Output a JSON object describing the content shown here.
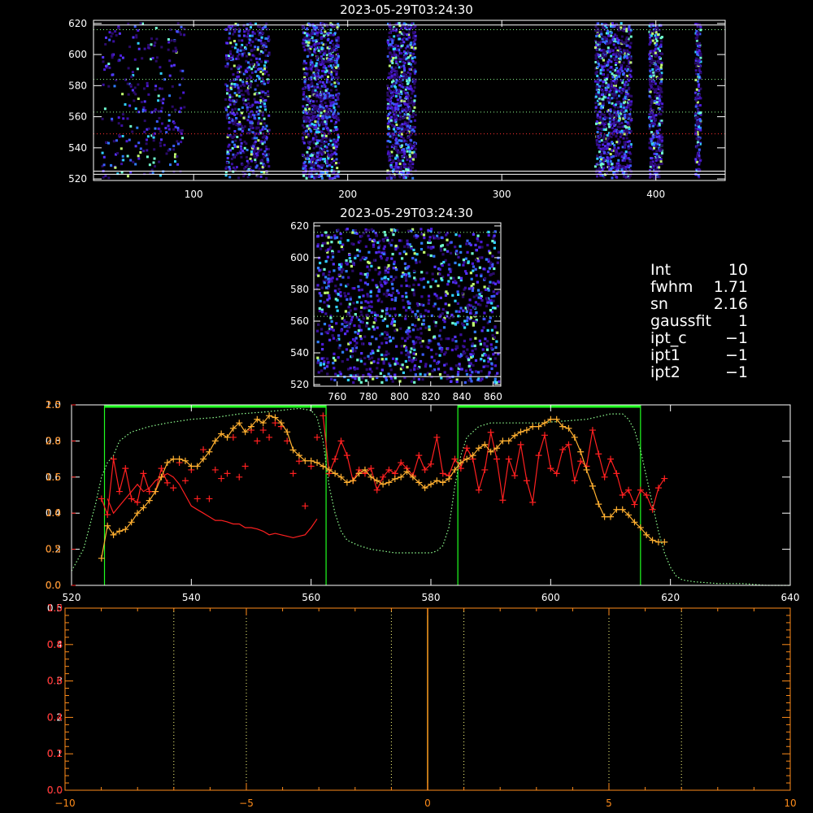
{
  "colors": {
    "background": "#000000",
    "axes": "#ffffff",
    "profile_red": "#ff2020",
    "profile_orange": "#ffb030",
    "guide_dotted": "#90ff90",
    "region_green": "#20ff20",
    "bottom_axes": "#ff8c1a",
    "bottom_dotted": "#ffff80",
    "center_line": "#ffa020"
  },
  "stats": [
    {
      "key": "Int",
      "value": "10"
    },
    {
      "key": "fwhm",
      "value": "1.71"
    },
    {
      "key": "sn",
      "value": "2.16"
    },
    {
      "key": "gaussfit",
      "value": "1"
    },
    {
      "key": "ipt_c",
      "value": "−1"
    },
    {
      "key": "ipt1",
      "value": "−1"
    },
    {
      "key": "ipt2",
      "value": "−1"
    }
  ],
  "chart_data": [
    {
      "type": "heatmap",
      "title": "2023-05-29T03:24:30",
      "xlim": [
        35,
        445
      ],
      "ylim": [
        519,
        622
      ],
      "x_ticks": [
        "100",
        "200",
        "300",
        "400"
      ],
      "y_ticks": [
        "520",
        "540",
        "560",
        "580",
        "600",
        "620"
      ],
      "bright_bands_x": [
        [
          40,
          95
        ],
        [
          120,
          150
        ],
        [
          170,
          195
        ],
        [
          225,
          245
        ],
        [
          360,
          385
        ],
        [
          395,
          405
        ],
        [
          425,
          430
        ]
      ],
      "horizontal_lines": [
        {
          "y": 619,
          "style": "solid",
          "color": "#ffffff"
        },
        {
          "y": 616,
          "style": "dotted",
          "color": "#90ff90"
        },
        {
          "y": 584,
          "style": "dotted",
          "color": "#90ff90"
        },
        {
          "y": 563,
          "style": "dotted",
          "color": "#90ff90"
        },
        {
          "y": 549,
          "style": "dotted",
          "color": "#ff3030"
        },
        {
          "y": 525,
          "style": "solid",
          "color": "#ffffff"
        },
        {
          "y": 523,
          "style": "solid",
          "color": "#ffffff"
        }
      ]
    },
    {
      "type": "heatmap",
      "title": "2023-05-29T03:24:30",
      "xlim": [
        745,
        865
      ],
      "ylim": [
        519,
        622
      ],
      "x_ticks": [
        "760",
        "780",
        "800",
        "820",
        "840",
        "860"
      ],
      "y_ticks": [
        "520",
        "540",
        "560",
        "580",
        "600",
        "620"
      ],
      "horizontal_lines": [
        {
          "y": 616,
          "style": "dotted",
          "color": "#90ff90"
        },
        {
          "y": 563,
          "style": "dotted",
          "color": "#90ff90"
        },
        {
          "y": 525,
          "style": "solid",
          "color": "#ffffff"
        }
      ]
    },
    {
      "type": "line",
      "xlim": [
        520,
        640
      ],
      "ylim": [
        0,
        1.0
      ],
      "x_ticks": [
        "520",
        "540",
        "560",
        "580",
        "600",
        "620",
        "640"
      ],
      "y_ticks_white": [
        "0.0",
        "0.2",
        "0.4",
        "0.6",
        "0.8",
        "1.0"
      ],
      "y_ticks_orange": [
        "0.0",
        "0.5",
        "1.0",
        "1.5",
        "2.0",
        "2.5"
      ],
      "regions": [
        [
          525.5,
          562.5
        ],
        [
          584.5,
          615
        ]
      ],
      "series": [
        {
          "color": "#ff2020",
          "marker": "+",
          "x": [
            525,
            526,
            527,
            528,
            529,
            530,
            531,
            532,
            533,
            534,
            535,
            536,
            537,
            538,
            539,
            540,
            541,
            542,
            543,
            544,
            545,
            546,
            547,
            548,
            549,
            550,
            551,
            552,
            553,
            554,
            555,
            556,
            557,
            558,
            559,
            560,
            561,
            562,
            563,
            564,
            565,
            566,
            567,
            568,
            569,
            570,
            571,
            572,
            573,
            574,
            575,
            576,
            577,
            578,
            579,
            580,
            581,
            582,
            583,
            584,
            585,
            586,
            587,
            588,
            589,
            590,
            591,
            592,
            593,
            594,
            595,
            596,
            597,
            598,
            599,
            600,
            601,
            602,
            603,
            604,
            605,
            606,
            607,
            608,
            609,
            610,
            611,
            612,
            613,
            614,
            615,
            616,
            617,
            618,
            619
          ],
          "y": [
            1.2,
            0.98,
            1.75,
            1.3,
            1.62,
            1.2,
            1.15,
            1.55,
            1.3,
            1.3,
            1.62,
            1.42,
            1.35,
            1.7,
            1.45,
            1.6,
            1.2,
            1.88,
            1.2,
            1.6,
            1.48,
            1.55,
            2.05,
            1.5,
            1.65,
            2.15,
            2.0,
            2.15,
            2.05,
            2.25,
            2.2,
            2.0,
            1.55,
            1.72,
            1.1,
            1.65,
            2.05,
            2.35,
            1.55,
            1.75,
            2.0,
            1.8,
            1.45,
            1.6,
            1.55,
            1.62,
            1.32,
            1.5,
            1.6,
            1.55,
            1.7,
            1.62,
            1.52,
            1.8,
            1.6,
            1.68,
            2.05,
            1.55,
            1.52,
            1.75,
            1.62,
            1.9,
            1.75,
            1.32,
            1.6,
            2.12,
            1.75,
            1.18,
            1.75,
            1.52,
            1.95,
            1.45,
            1.15,
            1.8,
            2.08,
            1.62,
            1.55,
            1.88,
            1.95,
            1.45,
            1.72,
            1.65,
            2.15,
            1.82,
            1.5,
            1.75,
            1.55,
            1.25,
            1.32,
            1.12,
            1.32,
            1.25,
            1.05,
            1.35,
            1.48
          ],
          "x2": [
            526,
            527,
            528,
            529,
            530,
            531,
            532,
            533,
            534,
            535,
            536,
            537,
            538,
            539,
            540,
            541,
            542,
            543,
            544,
            545,
            546,
            547,
            548,
            549,
            550,
            551,
            552,
            553,
            554,
            555,
            556,
            557,
            558,
            559,
            560,
            561
          ],
          "y2": [
            1.2,
            1.0,
            1.1,
            1.2,
            1.3,
            1.4,
            1.3,
            1.35,
            1.45,
            1.5,
            1.55,
            1.5,
            1.4,
            1.25,
            1.1,
            1.05,
            1.0,
            0.95,
            0.9,
            0.9,
            0.88,
            0.85,
            0.85,
            0.8,
            0.8,
            0.78,
            0.75,
            0.7,
            0.72,
            0.7,
            0.68,
            0.66,
            0.68,
            0.7,
            0.8,
            0.92
          ]
        },
        {
          "color": "#ffb030",
          "marker": "+",
          "x": [
            525,
            526,
            527,
            528,
            529,
            530,
            531,
            532,
            533,
            534,
            535,
            536,
            537,
            538,
            539,
            540,
            541,
            542,
            543,
            544,
            545,
            546,
            547,
            548,
            549,
            550,
            551,
            552,
            553,
            554,
            555,
            556,
            557,
            558,
            559,
            560,
            561,
            562,
            563,
            564,
            565,
            566,
            567,
            568,
            569,
            570,
            571,
            572,
            573,
            574,
            575,
            576,
            577,
            578,
            579,
            580,
            581,
            582,
            583,
            584,
            585,
            586,
            587,
            588,
            589,
            590,
            591,
            592,
            593,
            594,
            595,
            596,
            597,
            598,
            599,
            600,
            601,
            602,
            603,
            604,
            605,
            606,
            607,
            608,
            609,
            610,
            611,
            612,
            613,
            614,
            615,
            616,
            617,
            618,
            619
          ],
          "y": [
            0.15,
            0.33,
            0.28,
            0.3,
            0.31,
            0.35,
            0.4,
            0.43,
            0.47,
            0.52,
            0.6,
            0.68,
            0.7,
            0.7,
            0.69,
            0.66,
            0.66,
            0.7,
            0.74,
            0.8,
            0.84,
            0.82,
            0.87,
            0.9,
            0.85,
            0.88,
            0.92,
            0.9,
            0.94,
            0.93,
            0.9,
            0.85,
            0.75,
            0.72,
            0.69,
            0.69,
            0.68,
            0.66,
            0.64,
            0.62,
            0.6,
            0.57,
            0.58,
            0.62,
            0.64,
            0.6,
            0.58,
            0.56,
            0.57,
            0.59,
            0.6,
            0.63,
            0.6,
            0.57,
            0.54,
            0.56,
            0.58,
            0.57,
            0.59,
            0.64,
            0.68,
            0.7,
            0.72,
            0.76,
            0.78,
            0.74,
            0.76,
            0.8,
            0.8,
            0.83,
            0.85,
            0.86,
            0.88,
            0.88,
            0.9,
            0.92,
            0.92,
            0.88,
            0.87,
            0.82,
            0.74,
            0.64,
            0.55,
            0.45,
            0.38,
            0.38,
            0.42,
            0.42,
            0.39,
            0.35,
            0.32,
            0.28,
            0.25,
            0.24,
            0.24
          ]
        },
        {
          "color": "#90ff90",
          "style": "dotted",
          "x": [
            520,
            522,
            524,
            525,
            526,
            527,
            528,
            530,
            533,
            536,
            540,
            544,
            548,
            552,
            555,
            558,
            560,
            561,
            562,
            563,
            564,
            565,
            566,
            568,
            570,
            574,
            578,
            580,
            581,
            582,
            583,
            584,
            585,
            586,
            588,
            590,
            594,
            598,
            602,
            606,
            610,
            612,
            613,
            614,
            615,
            616,
            617,
            618,
            619,
            620,
            621,
            622,
            624,
            628,
            632,
            636,
            640
          ],
          "y": [
            0.08,
            0.2,
            0.45,
            0.6,
            0.68,
            0.72,
            0.8,
            0.85,
            0.88,
            0.9,
            0.92,
            0.93,
            0.95,
            0.96,
            0.97,
            0.98,
            0.97,
            0.93,
            0.8,
            0.55,
            0.4,
            0.3,
            0.25,
            0.22,
            0.2,
            0.18,
            0.18,
            0.18,
            0.19,
            0.22,
            0.32,
            0.55,
            0.72,
            0.82,
            0.88,
            0.9,
            0.9,
            0.9,
            0.91,
            0.92,
            0.95,
            0.95,
            0.92,
            0.86,
            0.75,
            0.6,
            0.45,
            0.3,
            0.18,
            0.1,
            0.05,
            0.03,
            0.02,
            0.01,
            0.01,
            0.0,
            0.0
          ]
        }
      ]
    },
    {
      "type": "line",
      "xlim": [
        -10,
        10
      ],
      "ylim": [
        0,
        0.5
      ],
      "x_ticks": [
        "−10",
        "−5",
        "0",
        "5",
        "10"
      ],
      "y_ticks_white": [
        "0.0",
        "0.1",
        "0.2",
        "0.3",
        "0.4",
        "0.5"
      ],
      "y_ticks_orange": [
        "0.0",
        "0.2",
        "0.4",
        "0.6",
        "0.8",
        "1.0"
      ],
      "vlines_dotted": [
        -7,
        -5,
        -1,
        1,
        5,
        7
      ],
      "vline_center": 0
    }
  ]
}
